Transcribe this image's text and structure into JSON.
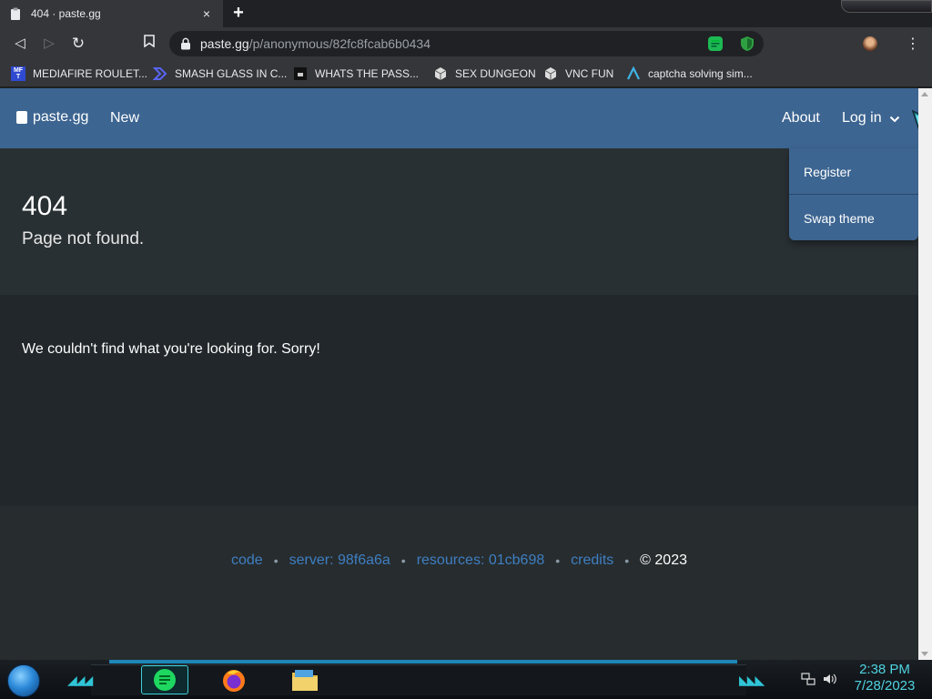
{
  "browser": {
    "tab_title": "404 · paste.gg",
    "tab_close": "×",
    "new_tab": "+",
    "url_host": "paste.gg",
    "url_path": "/p/anonymous/82fc8fcab6b0434",
    "back": "◁",
    "forward": "▷",
    "reload": "↻",
    "menu": "⋮"
  },
  "bookmarks": [
    {
      "label": "MEDIAFIRE ROULET...",
      "icon": "MF T",
      "color": "#2f4ad0"
    },
    {
      "label": "SMASH GLASS IN C...",
      "icon": "chevron-logo",
      "color": "#3b48c8"
    },
    {
      "label": "WHATS THE PASS...",
      "icon": "dark-logo",
      "color": "#111111"
    },
    {
      "label": "SEX DUNGEON",
      "icon": "cube-logo",
      "color": "#cccccc"
    },
    {
      "label": "VNC FUN",
      "icon": "cube-logo",
      "color": "#cccccc"
    },
    {
      "label": "captcha solving sim...",
      "icon": "caret-logo",
      "color": "#3fb4e6"
    }
  ],
  "site": {
    "brand": "paste.gg",
    "nav_new": "New",
    "nav_about": "About",
    "nav_login": "Log in",
    "dropdown": {
      "register": "Register",
      "swap_theme": "Swap theme"
    },
    "hero_code": "404",
    "hero_sub": "Page not found.",
    "message": "We couldn't find what you're looking for. Sorry!",
    "footer": {
      "code": "code",
      "server": "server: 98f6a6a",
      "resources": "resources: 01cb698",
      "credits": "credits",
      "copyright": "© 2023",
      "sep": "•"
    }
  },
  "taskbar": {
    "time": "2:38 PM",
    "date": "7/28/2023"
  },
  "colors": {
    "navbar": "#3d6591",
    "link": "#3e7fc3",
    "accent": "#2fc4d6"
  }
}
